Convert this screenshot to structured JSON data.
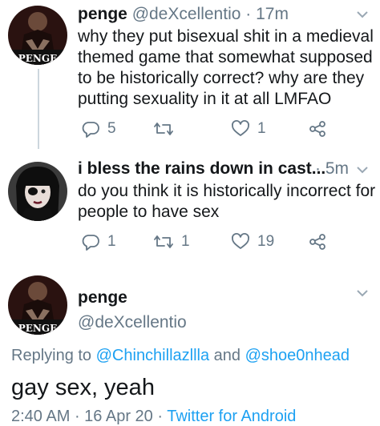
{
  "tweet1": {
    "display_name": "penge",
    "handle": "@deXcellentio",
    "separator": " · ",
    "time": "17m",
    "avatar_caption": "PENGE",
    "lines": [
      "why they put bisexual shit in a medieval",
      "themed game that somewhat supposed",
      "to be historically correct? why are they",
      "putting sexuality in it at all LMFAO"
    ],
    "reply_count": "5",
    "retweet_count": "",
    "like_count": "1"
  },
  "tweet2": {
    "display_name": "i bless the rains down in cast...",
    "separator": " · ",
    "time": "5m",
    "lines": [
      "do you think it is historically incorrect for",
      "people to have sex"
    ],
    "reply_count": "1",
    "retweet_count": "1",
    "like_count": "19"
  },
  "main": {
    "display_name": "penge",
    "handle": "@deXcellentio",
    "avatar_caption": "PENGE",
    "replying_prefix": "Replying to ",
    "replying_user1": "@Chinchillazllla",
    "replying_and": " and ",
    "replying_user2": "@shoe0nhead",
    "text": "gay sex, yeah",
    "time": "2:40 AM",
    "sep1": " · ",
    "date": "16 Apr 20",
    "sep2": " · ",
    "source": "Twitter for Android"
  },
  "colors": {
    "text": "#14171a",
    "meta": "#657786",
    "link": "#1da1f2",
    "line": "#ccd6dd"
  }
}
